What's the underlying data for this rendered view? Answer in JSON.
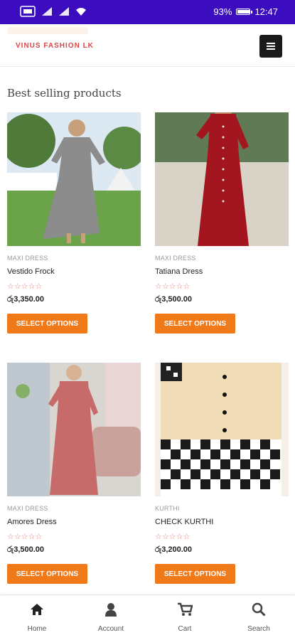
{
  "status_bar": {
    "battery": "93%",
    "time": "12:47",
    "battery_level": 0.93
  },
  "header": {
    "logo_text": "VINUS FASHION LK"
  },
  "section_title": "Best selling products",
  "products": [
    {
      "category": "MAXI DRESS",
      "name": "Vestido Frock",
      "rating": "☆☆☆☆☆",
      "price": "රු3,350.00",
      "button": "SELECT OPTIONS"
    },
    {
      "category": "MAXI DRESS",
      "name": "Tatiana Dress",
      "rating": "☆☆☆☆☆",
      "price": "රු3,500.00",
      "button": "SELECT OPTIONS"
    },
    {
      "category": "MAXI DRESS",
      "name": "Amores Dress",
      "rating": "☆☆☆☆☆",
      "price": "රු3,500.00",
      "button": "SELECT OPTIONS"
    },
    {
      "category": "KURTHI",
      "name": "CHECK KURTHI",
      "rating": "☆☆☆☆☆",
      "price": "රු3,200.00",
      "button": "SELECT OPTIONS"
    }
  ],
  "bottom_nav": [
    {
      "label": "Home",
      "icon": "home-icon"
    },
    {
      "label": "Account",
      "icon": "account-icon"
    },
    {
      "label": "Cart",
      "icon": "cart-icon"
    },
    {
      "label": "Search",
      "icon": "search-icon"
    }
  ]
}
